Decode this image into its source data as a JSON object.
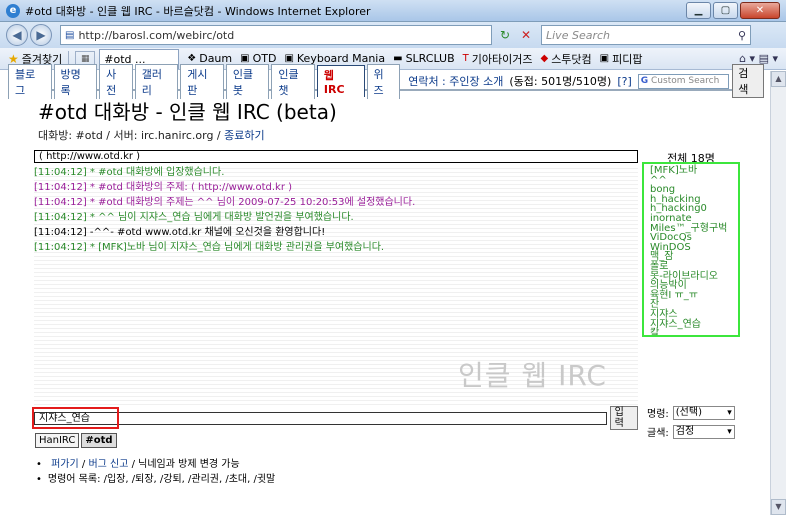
{
  "browser": {
    "window_title": "#otd 대화방 - 인클 웹 IRC - 바르슬닷컴 - Windows Internet Explorer",
    "url": "http://barosl.com/webirc/otd",
    "search_placeholder": "Live Search",
    "favorites_label": "즐겨찾기",
    "current_tab": "#otd ...",
    "links": [
      "Daum",
      "OTD",
      "Keyboard Mania",
      "SLRCLUB",
      "기아타이거즈",
      "스투닷컴",
      "피디팝"
    ]
  },
  "menu": {
    "items": [
      "블로그",
      "방명록",
      "사전",
      "갤러리",
      "게시판",
      "인클봇",
      "인클챗",
      "웹 IRC",
      "위즈"
    ],
    "active_index": 7,
    "contact": "연락처 : 주인장 소개",
    "counter": "(동접: 501명/510명)",
    "help": "[?]",
    "google_placeholder": "Custom Search",
    "search_button": "검색"
  },
  "page": {
    "title": "#otd 대화방 - 인클 웹 IRC (beta)",
    "channel_info": "대화방: #otd / 서버: irc.hanirc.org /",
    "quit_link": "종료하기",
    "topic_url": "( http://www.otd.kr )",
    "watermark": "인클 웹 IRC"
  },
  "chat": {
    "lines": [
      {
        "time": "[11:04:12]",
        "text": "* #otd 대화방에 입장했습니다.",
        "color": "green"
      },
      {
        "time": "[11:04:12]",
        "text": "* #otd 대화방의 주제: ( http://www.otd.kr )",
        "color": "purple"
      },
      {
        "time": "[11:04:12]",
        "text": "* #otd 대화방의 주제는 ^^ 님이 2009-07-25 10:20:53에 설정했습니다.",
        "color": "purple"
      },
      {
        "time": "[11:04:12]",
        "text": "* ^^ 님이 지쟈스_연습 님에게 대화방 발언권을 부여했습니다.",
        "color": "green"
      },
      {
        "time": "[11:04:12]",
        "text": "-^^- #otd www.otd.kr 채널에 오신것을 환영합니다!",
        "color": "black"
      },
      {
        "time": "[11:04:12]",
        "text": "* [MFK]노바 님이 지쟈스_연습 님에게 대화방 관리권을 부여했습니다.",
        "color": "green"
      }
    ]
  },
  "users": {
    "header": "전체 18명",
    "list": [
      "[MFK]노바",
      "^^",
      "bong",
      "h_hacking",
      "h_hacking0",
      "inornate",
      "Miles™_구형구벅",
      "ViDocQs",
      "WinDOS",
      "맥_잠",
      "폴로",
      "못-라이브라디오",
      "의능박이",
      "육현I ㅠ_ㅠ",
      "잔",
      "지쟈스",
      "지쟈스_연습",
      "칼"
    ]
  },
  "input": {
    "nickname": "지쟈스_연습",
    "send_label": "입력",
    "command_label": "명령:",
    "command_value": "(선택)",
    "color_label": "글색:",
    "color_value": "검정"
  },
  "servers": [
    "HanIRC",
    "#otd"
  ],
  "notes": {
    "line1_link1": "퍼가기",
    "line1_sep": " / ",
    "line1_link2": "버그 신고",
    "line1_text": " / 닉네임과 방제 변경 가능",
    "line2": "명령어 목록: /입장, /퇴장, /강퇴, /관리권, /초대, /귓말"
  }
}
